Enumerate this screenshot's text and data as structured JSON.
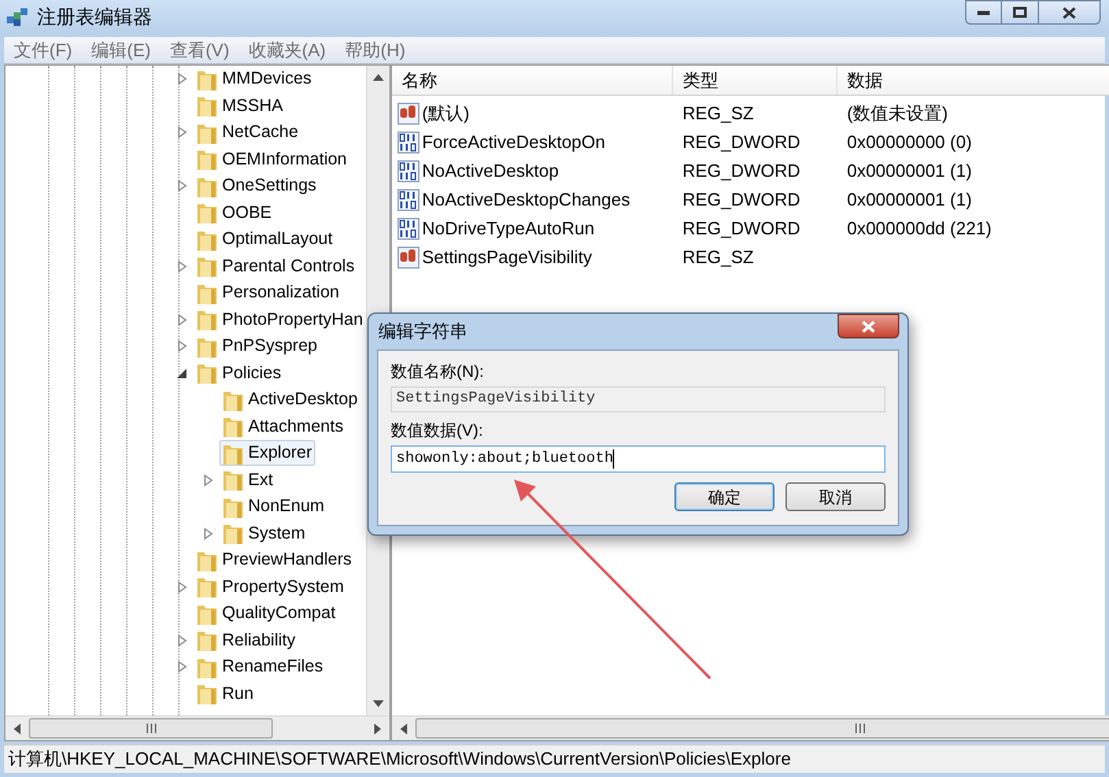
{
  "window": {
    "title": "注册表编辑器"
  },
  "menu": [
    "文件(F)",
    "编辑(E)",
    "查看(V)",
    "收藏夹(A)",
    "帮助(H)"
  ],
  "tree": [
    {
      "name": "MMDevices",
      "expandable": true,
      "expanded": false,
      "selected": false
    },
    {
      "name": "MSSHA",
      "expandable": false,
      "selected": false
    },
    {
      "name": "NetCache",
      "expandable": true,
      "expanded": false,
      "selected": false
    },
    {
      "name": "OEMInformation",
      "expandable": false,
      "selected": false
    },
    {
      "name": "OneSettings",
      "expandable": true,
      "expanded": false,
      "selected": false
    },
    {
      "name": "OOBE",
      "expandable": false,
      "selected": false
    },
    {
      "name": "OptimalLayout",
      "expandable": false,
      "selected": false
    },
    {
      "name": "Parental Controls",
      "expandable": true,
      "expanded": false,
      "selected": false
    },
    {
      "name": "Personalization",
      "expandable": false,
      "selected": false
    },
    {
      "name": "PhotoPropertyHan",
      "expandable": true,
      "expanded": false,
      "selected": false
    },
    {
      "name": "PnPSysprep",
      "expandable": true,
      "expanded": false,
      "selected": false
    },
    {
      "name": "Policies",
      "expandable": true,
      "expanded": true,
      "selected": false,
      "children": [
        {
          "name": "ActiveDesktop",
          "expandable": false,
          "selected": false
        },
        {
          "name": "Attachments",
          "expandable": false,
          "selected": false
        },
        {
          "name": "Explorer",
          "expandable": false,
          "selected": true
        },
        {
          "name": "Ext",
          "expandable": true,
          "expanded": false,
          "selected": false
        },
        {
          "name": "NonEnum",
          "expandable": false,
          "selected": false
        },
        {
          "name": "System",
          "expandable": true,
          "expanded": false,
          "selected": false
        }
      ]
    },
    {
      "name": "PreviewHandlers",
      "expandable": false,
      "selected": false
    },
    {
      "name": "PropertySystem",
      "expandable": true,
      "expanded": false,
      "selected": false
    },
    {
      "name": "QualityCompat",
      "expandable": false,
      "selected": false
    },
    {
      "name": "Reliability",
      "expandable": true,
      "expanded": false,
      "selected": false
    },
    {
      "name": "RenameFiles",
      "expandable": true,
      "expanded": false,
      "selected": false
    },
    {
      "name": "Run",
      "expandable": false,
      "selected": false
    }
  ],
  "values": {
    "columns": [
      "名称",
      "类型",
      "数据"
    ],
    "rows": [
      {
        "kind": "string",
        "name": "(默认)",
        "type": "REG_SZ",
        "data": "(数值未设置)"
      },
      {
        "kind": "dword",
        "name": "ForceActiveDesktopOn",
        "type": "REG_DWORD",
        "data": "0x00000000 (0)"
      },
      {
        "kind": "dword",
        "name": "NoActiveDesktop",
        "type": "REG_DWORD",
        "data": "0x00000001 (1)"
      },
      {
        "kind": "dword",
        "name": "NoActiveDesktopChanges",
        "type": "REG_DWORD",
        "data": "0x00000001 (1)"
      },
      {
        "kind": "dword",
        "name": "NoDriveTypeAutoRun",
        "type": "REG_DWORD",
        "data": "0x000000dd (221)"
      },
      {
        "kind": "string",
        "name": "SettingsPageVisibility",
        "type": "REG_SZ"
      }
    ]
  },
  "status_bar": "计算机\\HKEY_LOCAL_MACHINE\\SOFTWARE\\Microsoft\\Windows\\CurrentVersion\\Policies\\Explore",
  "dialog": {
    "title": "编辑字符串",
    "name_label": "数值名称(N):",
    "name_value": "SettingsPageVisibility",
    "data_label": "数值数据(V):",
    "data_value": "showonly:about;bluetooth",
    "buttons": [
      "确定",
      "取消"
    ]
  }
}
